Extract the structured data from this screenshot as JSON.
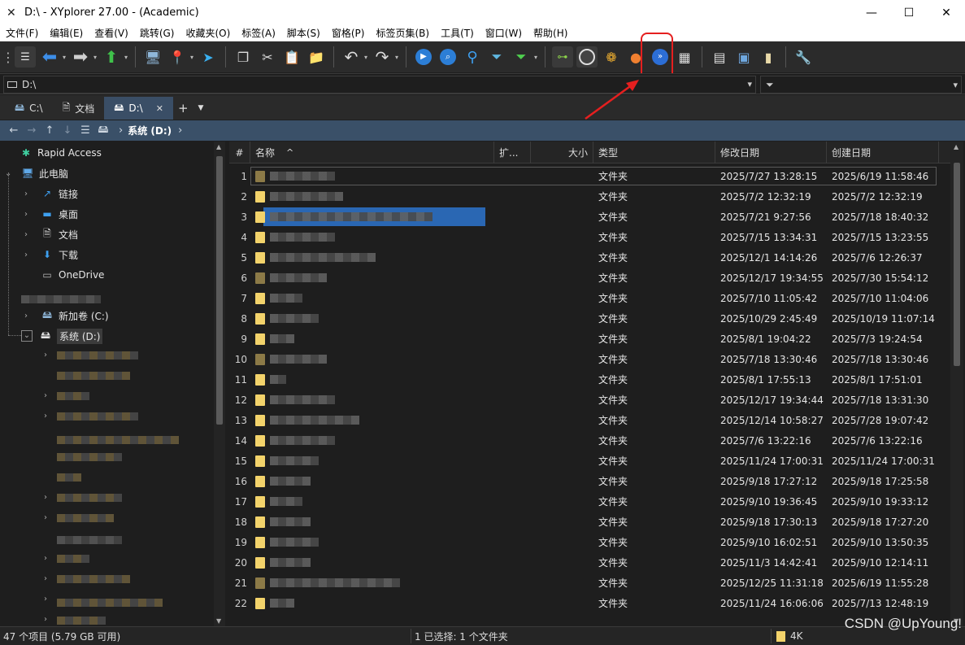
{
  "window": {
    "title": "D:\\ - XYplorer 27.00 - (Academic)",
    "app_icon": "xyplorer-logo-icon",
    "controls": [
      "minimize-icon",
      "maximize-icon",
      "close-icon"
    ]
  },
  "menu": [
    "文件(F)",
    "编辑(E)",
    "查看(V)",
    "跳转(G)",
    "收藏夹(O)",
    "标签(A)",
    "脚本(S)",
    "窗格(P)",
    "标签页集(B)",
    "工具(T)",
    "窗口(W)",
    "帮助(H)"
  ],
  "toolbar": {
    "buttons": [
      "menu-icon",
      "back-arrow-icon",
      "forward-arrow-icon",
      "up-arrow-icon",
      "computer-icon",
      "location-pin-icon",
      "cursor-icon",
      "copy-icon",
      "cut-icon",
      "paste-icon",
      "new-folder-icon",
      "undo-icon",
      "redo-icon",
      "play-icon",
      "search-icon",
      "find-icon",
      "filter-icon",
      "green-filter-icon",
      "tree-icon",
      "dark-mode-icon",
      "color-filter-icon",
      "basketball-icon",
      "fast-icon",
      "grid-icon",
      "pane-icon",
      "window-icon",
      "note-icon",
      "tools-icon"
    ],
    "highlight_color": "#e51f1f"
  },
  "address": {
    "path": "D:\\",
    "filter_placeholder": ""
  },
  "tabs": [
    {
      "label": "C:\\",
      "icon": "drive-icon"
    },
    {
      "label": "文档",
      "icon": "document-icon"
    },
    {
      "label": "D:\\",
      "icon": "drive-icon",
      "active": true
    }
  ],
  "breadcrumb": {
    "current": "系统 (D:)"
  },
  "tree": {
    "rapid_access": "Rapid Access",
    "this_pc": "此电脑",
    "links": "链接",
    "desktop": "桌面",
    "documents": "文档",
    "downloads": "下载",
    "onedrive": "OneDrive",
    "new_volume_c": "新加卷 (C:)",
    "system_d": "系统 (D:)"
  },
  "list": {
    "columns": {
      "num": "#",
      "name": "名称",
      "ext": "扩...",
      "size": "大小",
      "type": "类型",
      "modified": "修改日期",
      "created": "创建日期"
    },
    "rows": [
      {
        "n": "1",
        "type": "文件夹",
        "modified": "2025/7/27 13:28:15",
        "created": "2025/6/19 11:58:46"
      },
      {
        "n": "2",
        "type": "文件夹",
        "modified": "2025/7/2 12:32:19",
        "created": "2025/7/2 12:32:19"
      },
      {
        "n": "3",
        "type": "文件夹",
        "modified": "2025/7/21 9:27:56",
        "created": "2025/7/18 18:40:32"
      },
      {
        "n": "4",
        "type": "文件夹",
        "modified": "2025/7/15 13:34:31",
        "created": "2025/7/15 13:23:55"
      },
      {
        "n": "5",
        "type": "文件夹",
        "modified": "2025/12/1 14:14:26",
        "created": "2025/7/6 12:26:37"
      },
      {
        "n": "6",
        "type": "文件夹",
        "modified": "2025/12/17 19:34:55",
        "created": "2025/7/30 15:54:12"
      },
      {
        "n": "7",
        "type": "文件夹",
        "modified": "2025/7/10 11:05:42",
        "created": "2025/7/10 11:04:06"
      },
      {
        "n": "8",
        "type": "文件夹",
        "modified": "2025/10/29 2:45:49",
        "created": "2025/10/19 11:07:14"
      },
      {
        "n": "9",
        "type": "文件夹",
        "modified": "2025/8/1 19:04:22",
        "created": "2025/7/3 19:24:54"
      },
      {
        "n": "10",
        "type": "文件夹",
        "modified": "2025/7/18 13:30:46",
        "created": "2025/7/18 13:30:46"
      },
      {
        "n": "11",
        "type": "文件夹",
        "modified": "2025/8/1 17:55:13",
        "created": "2025/8/1 17:51:01"
      },
      {
        "n": "12",
        "type": "文件夹",
        "modified": "2025/12/17 19:34:44",
        "created": "2025/7/18 13:31:30"
      },
      {
        "n": "13",
        "type": "文件夹",
        "modified": "2025/12/14 10:58:27",
        "created": "2025/7/28 19:07:42"
      },
      {
        "n": "14",
        "type": "文件夹",
        "modified": "2025/7/6 13:22:16",
        "created": "2025/7/6 13:22:16"
      },
      {
        "n": "15",
        "type": "文件夹",
        "modified": "2025/11/24 17:00:31",
        "created": "2025/11/24 17:00:31"
      },
      {
        "n": "16",
        "type": "文件夹",
        "modified": "2025/9/18 17:27:12",
        "created": "2025/9/18 17:25:58"
      },
      {
        "n": "17",
        "type": "文件夹",
        "modified": "2025/9/10 19:36:45",
        "created": "2025/9/10 19:33:12"
      },
      {
        "n": "18",
        "type": "文件夹",
        "modified": "2025/9/18 17:30:13",
        "created": "2025/9/18 17:27:20"
      },
      {
        "n": "19",
        "type": "文件夹",
        "modified": "2025/9/10 16:02:51",
        "created": "2025/9/10 13:50:35"
      },
      {
        "n": "20",
        "type": "文件夹",
        "modified": "2025/11/3 14:42:41",
        "created": "2025/9/10 12:14:11"
      },
      {
        "n": "21",
        "type": "文件夹",
        "modified": "2025/12/25 11:31:18",
        "created": "2025/6/19 11:55:28"
      },
      {
        "n": "22",
        "type": "文件夹",
        "modified": "2025/11/24 16:06:06",
        "created": "2025/7/13 12:48:19"
      }
    ]
  },
  "status": {
    "items": "47 个项目 (5.79 GB 可用)",
    "selection": "1 已选择: 1 个文件夹",
    "size": "4K"
  },
  "watermark": "CSDN @UpYoung!"
}
